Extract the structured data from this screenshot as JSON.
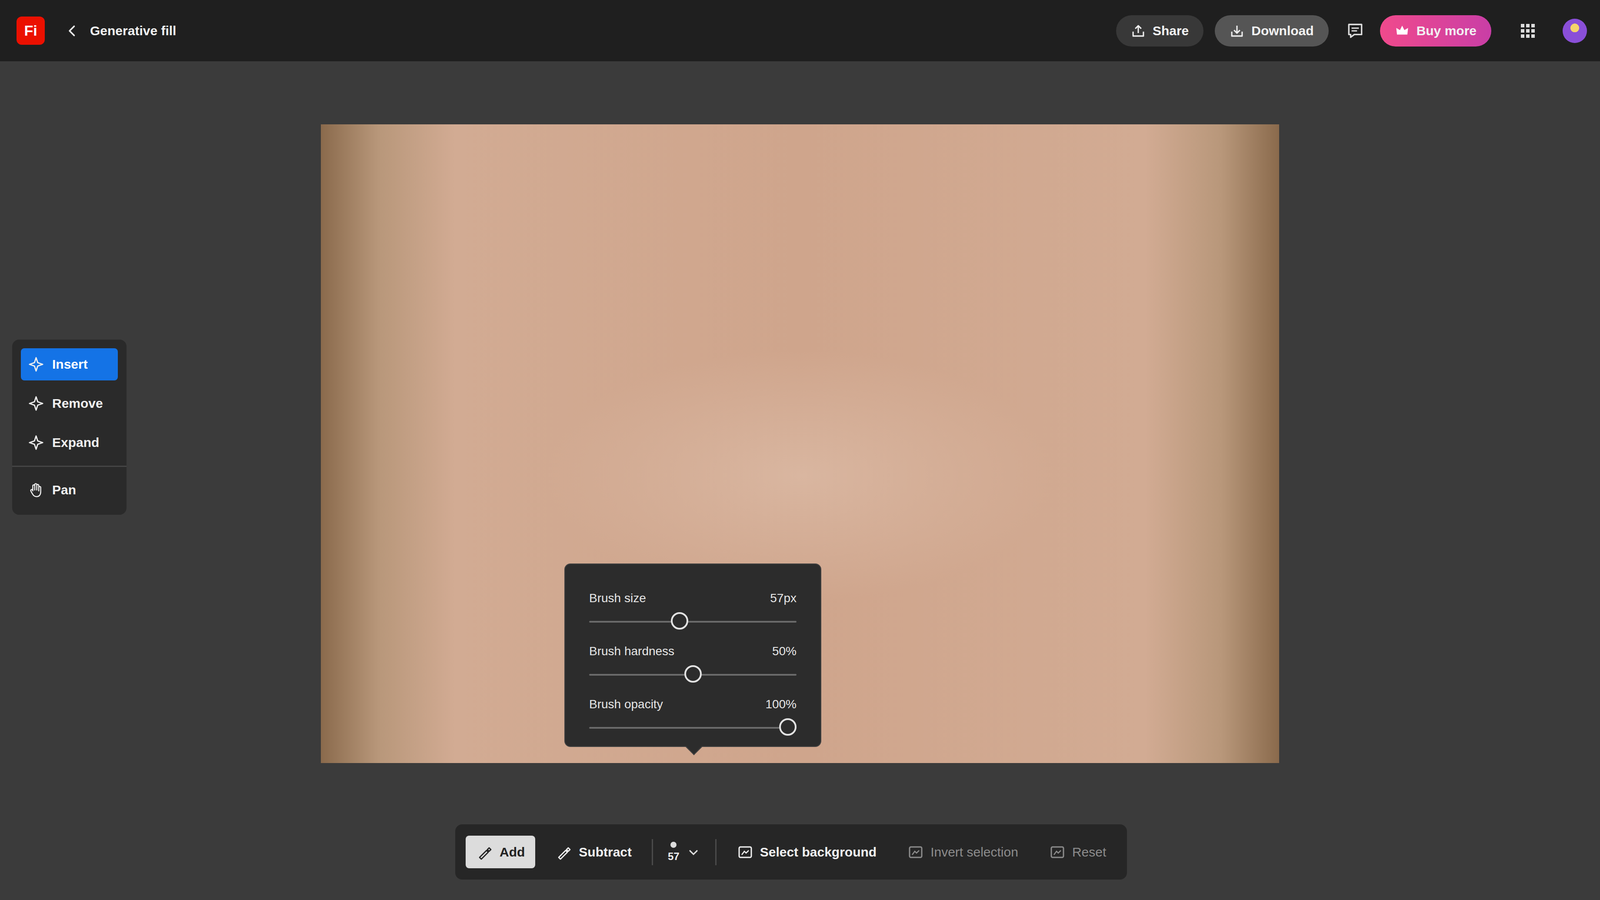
{
  "app": {
    "logo": "Fi",
    "title": "Generative fill"
  },
  "header_actions": [
    {
      "label": "Share"
    },
    {
      "label": "Download"
    },
    {
      "label": "Buy more"
    }
  ],
  "tools": [
    {
      "label": "Insert",
      "selected": true
    },
    {
      "label": "Remove",
      "selected": false
    },
    {
      "label": "Expand",
      "selected": false
    },
    {
      "label": "Pan",
      "selected": false
    }
  ],
  "brush_settings": [
    {
      "label": "Brush size",
      "reading": "57px",
      "level": 0.43
    },
    {
      "label": "Brush hardness",
      "reading": "50%",
      "level": 0.5
    },
    {
      "label": "Brush opacity",
      "reading": "100%",
      "level": 1
    }
  ],
  "selection_modes": [
    {
      "label": "Add",
      "selected": true
    },
    {
      "label": "Subtract",
      "selected": false
    }
  ],
  "brush_size_button": {
    "value": "57",
    "expanded": true
  },
  "actions": [
    {
      "label": "Select background",
      "disabled": false
    },
    {
      "label": "Invert selection",
      "disabled": true
    },
    {
      "label": "Reset",
      "disabled": true
    }
  ]
}
